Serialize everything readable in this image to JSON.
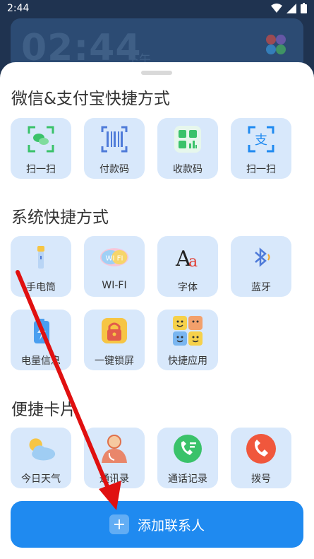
{
  "status": {
    "time": "2:44"
  },
  "widget": {
    "clock": "02:44",
    "ampm": "下午"
  },
  "sections": {
    "wechat_alipay": "微信&支付宝快捷方式",
    "system": "系统快捷方式",
    "cards": "便捷卡片"
  },
  "tiles": {
    "scan_wechat": "扫一扫",
    "pay_code": "付款码",
    "receive_code": "收款码",
    "scan_alipay": "扫一扫",
    "flashlight": "手电筒",
    "wifi": "WI-FI",
    "font": "字体",
    "bluetooth": "蓝牙",
    "battery": "电量信息",
    "lock": "一键锁屏",
    "shortcut_apps": "快捷应用",
    "weather": "今日天气",
    "contacts": "通讯录",
    "call_log": "通话记录",
    "dial": "拨号"
  },
  "icon_text": {
    "wifi": "WI FI",
    "font_big": "A",
    "font_small": "a",
    "alipay": "支"
  },
  "add_button": {
    "label": "添加联系人",
    "plus": "+"
  },
  "colors": {
    "accent": "#1f8af0",
    "tile": "#d8e8fb",
    "arrow": "#e01010"
  }
}
